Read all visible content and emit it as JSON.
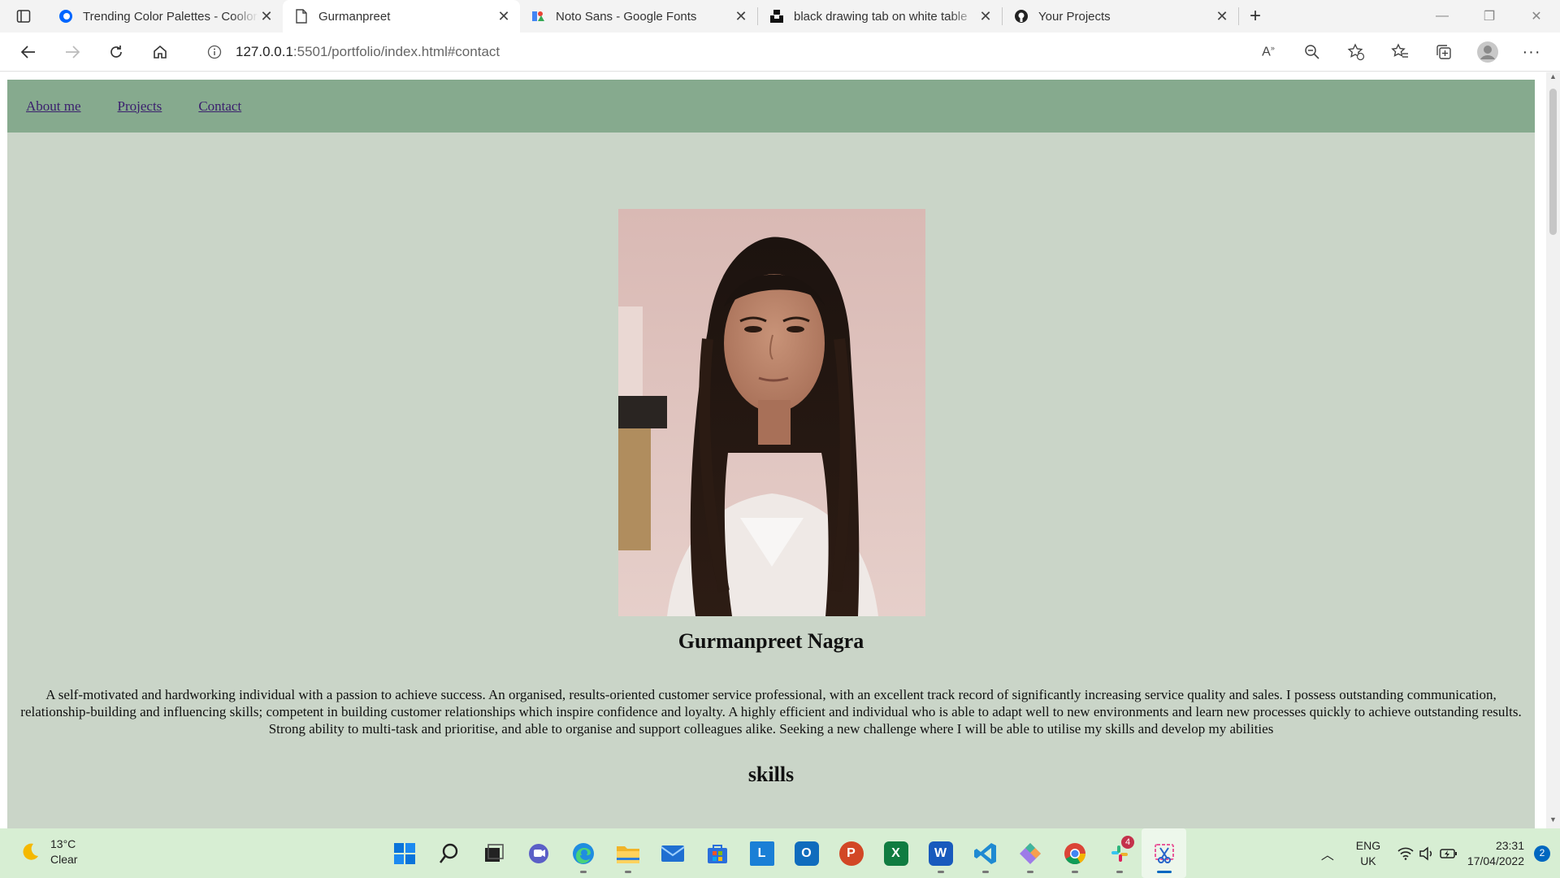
{
  "browser": {
    "tabs": [
      {
        "title": "Trending Color Palettes - Coolors",
        "icon": "coolors-icon",
        "active": false
      },
      {
        "title": "Gurmanpreet",
        "icon": "page-icon",
        "active": true
      },
      {
        "title": "Noto Sans - Google Fonts",
        "icon": "google-fonts-icon",
        "active": false
      },
      {
        "title": "black drawing tab on white table",
        "icon": "unsplash-icon",
        "active": false
      },
      {
        "title": "Your Projects",
        "icon": "github-icon",
        "active": false
      }
    ],
    "address": {
      "host": "127.0.0.1",
      "rest": ":5501/portfolio/index.html#contact"
    }
  },
  "page": {
    "nav": [
      "About me",
      "Projects",
      "Contact"
    ],
    "name": "Gurmanpreet Nagra",
    "bio": "A self-motivated and hardworking individual with a passion to achieve success. An organised, results-oriented customer service professional, with an excellent track record of significantly increasing service quality and sales. I possess outstanding communication, relationship-building and influencing skills; competent in building customer relationships which inspire confidence and loyalty. A highly efficient and individual who is able to adapt well to new environments and learn new processes quickly to achieve outstanding results. Strong ability to multi-task and prioritise, and able to organise and support colleagues alike. Seeking a new challenge where I will be able to utilise my skills and develop my abilities",
    "skills_heading": "skills",
    "colors": {
      "nav_bg": "#86aa8e",
      "page_bg": "#cad5c8",
      "link": "#3b1f6e"
    }
  },
  "taskbar": {
    "weather": {
      "temp": "13°C",
      "condition": "Clear"
    },
    "apps": [
      "start",
      "search",
      "task-view",
      "chat",
      "edge",
      "file-explorer",
      "mail",
      "store",
      "l-app",
      "outlook",
      "powerpoint",
      "excel",
      "word",
      "vscode",
      "git",
      "chrome",
      "slack",
      "snipping-tool"
    ],
    "slack_badge": "4",
    "language": {
      "lang": "ENG",
      "region": "UK"
    },
    "time": "23:31",
    "date": "17/04/2022",
    "notifications": "2"
  }
}
